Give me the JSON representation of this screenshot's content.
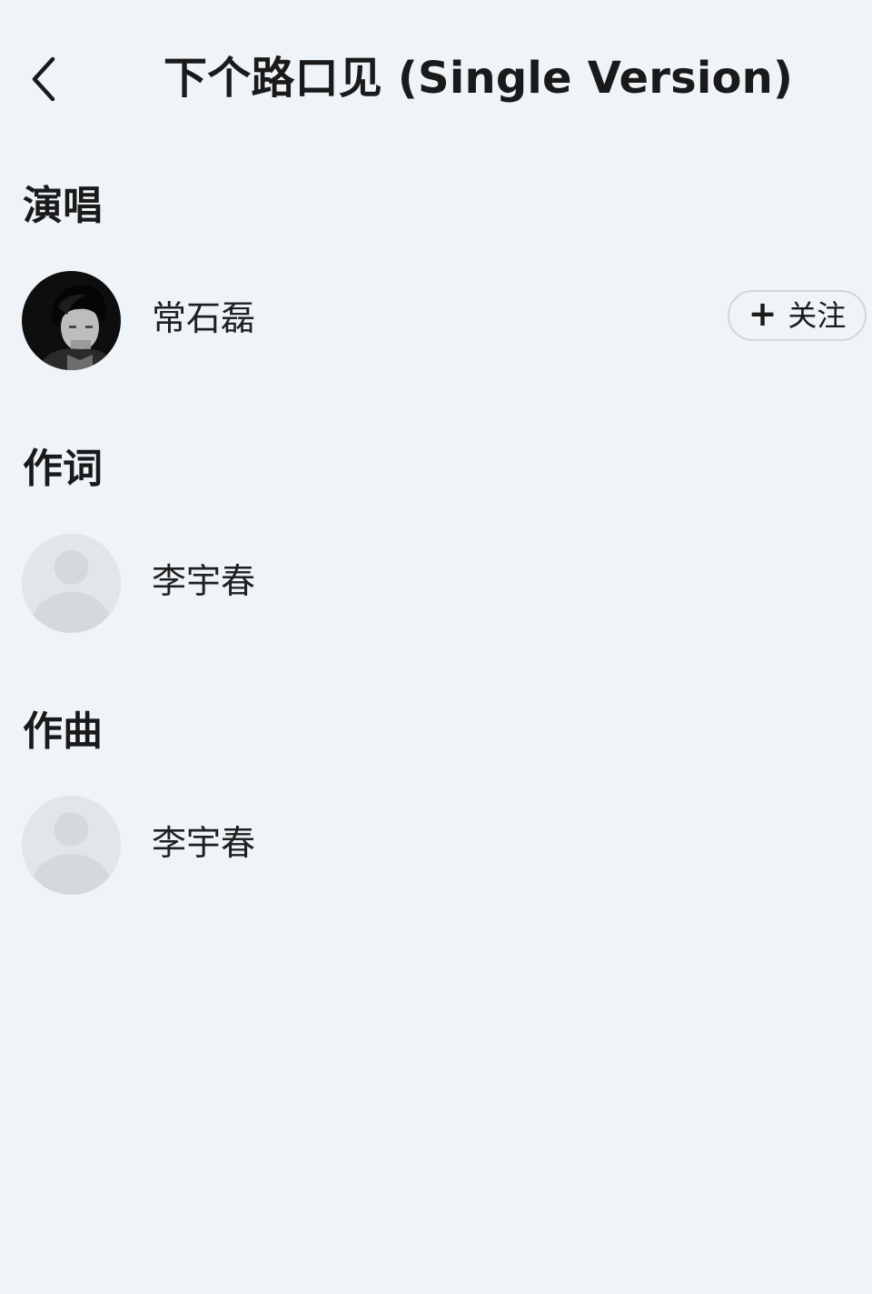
{
  "header": {
    "title": "下个路口见 (Single Version)",
    "back_icon": "chevron-left-icon"
  },
  "sections": [
    {
      "title": "演唱",
      "people": [
        {
          "name": "常石磊",
          "avatar": "artist-photo",
          "follow_plus": "+",
          "follow_label": "关注"
        }
      ]
    },
    {
      "title": "作词",
      "people": [
        {
          "name": "李宇春",
          "avatar": "default-avatar"
        }
      ]
    },
    {
      "title": "作曲",
      "people": [
        {
          "name": "李宇春",
          "avatar": "default-avatar"
        }
      ]
    }
  ],
  "colors": {
    "background": "#eff4f8",
    "text": "#1a1a1a",
    "follow_border": "#d2d6da",
    "placeholder_avatar": "#e2e5e8"
  }
}
